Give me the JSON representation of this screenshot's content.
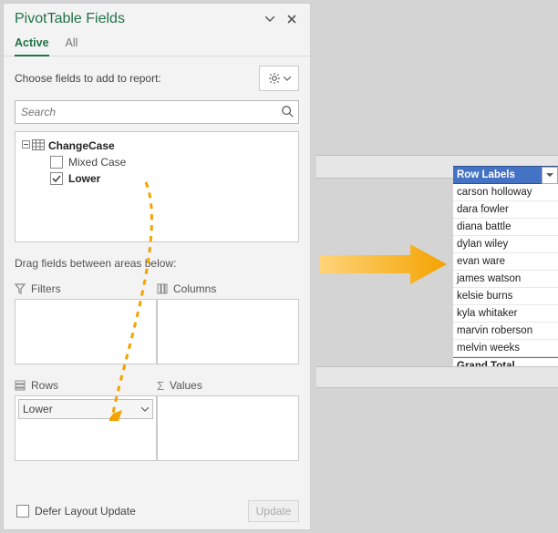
{
  "panel": {
    "title": "PivotTable Fields",
    "tabs": {
      "active": "Active",
      "all": "All"
    },
    "choose_label": "Choose fields to add to report:",
    "search_placeholder": "Search",
    "tree": {
      "table": "ChangeCase",
      "field1": "Mixed Case",
      "field2": "Lower"
    },
    "drag_label": "Drag fields between areas below:",
    "areas": {
      "filters": "Filters",
      "columns": "Columns",
      "rows": "Rows",
      "values": "Values"
    },
    "rows_chip": "Lower",
    "defer_label": "Defer Layout Update",
    "update_label": "Update"
  },
  "pivot": {
    "header": "Row Labels",
    "rows": [
      "carson holloway",
      "dara fowler",
      "diana battle",
      "dylan wiley",
      "evan ware",
      "james watson",
      "kelsie burns",
      "kyla whitaker",
      "marvin roberson",
      "melvin weeks"
    ],
    "grand_total": "Grand Total"
  },
  "sigma_glyph": "Σ"
}
